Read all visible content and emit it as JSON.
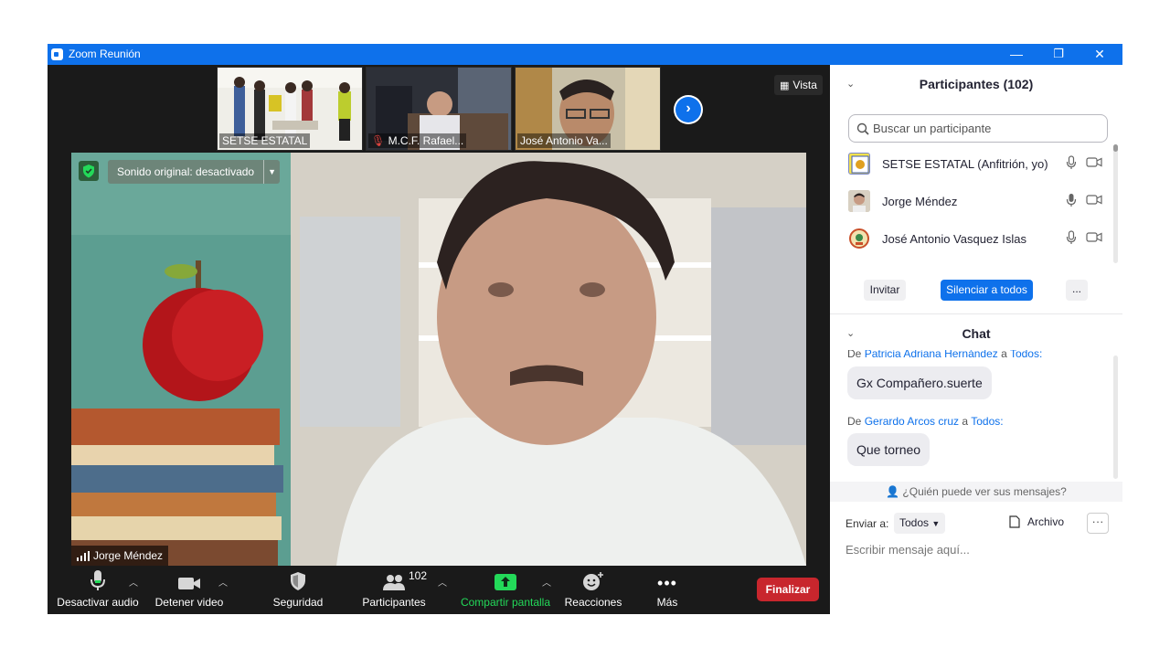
{
  "window": {
    "title": "Zoom Reunión",
    "minimize": "—",
    "restore": "❐",
    "close": "✕"
  },
  "thumbnails": [
    {
      "name": "SETSE ESTATAL",
      "muted": false
    },
    {
      "name": "M.C.F. Rafael...",
      "muted": true
    },
    {
      "name": "José Antonio Va...",
      "muted": false
    }
  ],
  "view_button": {
    "label": "Vista"
  },
  "main_video": {
    "speaker_name": "Jorge Méndez",
    "sound_label": "Sonido original: desactivado"
  },
  "toolbar": {
    "audio": "Desactivar audio",
    "video": "Detener video",
    "security": "Seguridad",
    "participants": "Participantes",
    "participant_count": "102",
    "share": "Compartir pantalla",
    "reactions": "Reacciones",
    "more": "Más",
    "end": "Finalizar"
  },
  "participants_panel": {
    "title": "Participantes (102)",
    "search_placeholder": "Buscar un participante",
    "list": [
      {
        "name": "SETSE ESTATAL (Anfitrión, yo)"
      },
      {
        "name": "Jorge Méndez"
      },
      {
        "name": "José Antonio Vasquez Islas"
      }
    ],
    "invite": "Invitar",
    "mute_all": "Silenciar a todos",
    "more": "..."
  },
  "chat": {
    "title": "Chat",
    "messages": [
      {
        "prefix": "De",
        "sender": "Patricia Adriana Hernández",
        "to_word": "a",
        "recipient": "Todos:",
        "text": "Gx Compañero.suerte"
      },
      {
        "prefix": "De",
        "sender": "Gerardo Arcos cruz",
        "to_word": "a",
        "recipient": "Todos:",
        "text": "Que torneo"
      }
    ],
    "privacy": "¿Quién puede ver sus mensajes?",
    "send_to_label": "Enviar a:",
    "send_to_value": "Todos",
    "file_label": "Archivo",
    "more": "···",
    "placeholder": "Escribir mensaje aquí..."
  },
  "colors": {
    "accent": "#0e71eb",
    "end_red": "#c8262d",
    "share_green": "#23d959"
  }
}
